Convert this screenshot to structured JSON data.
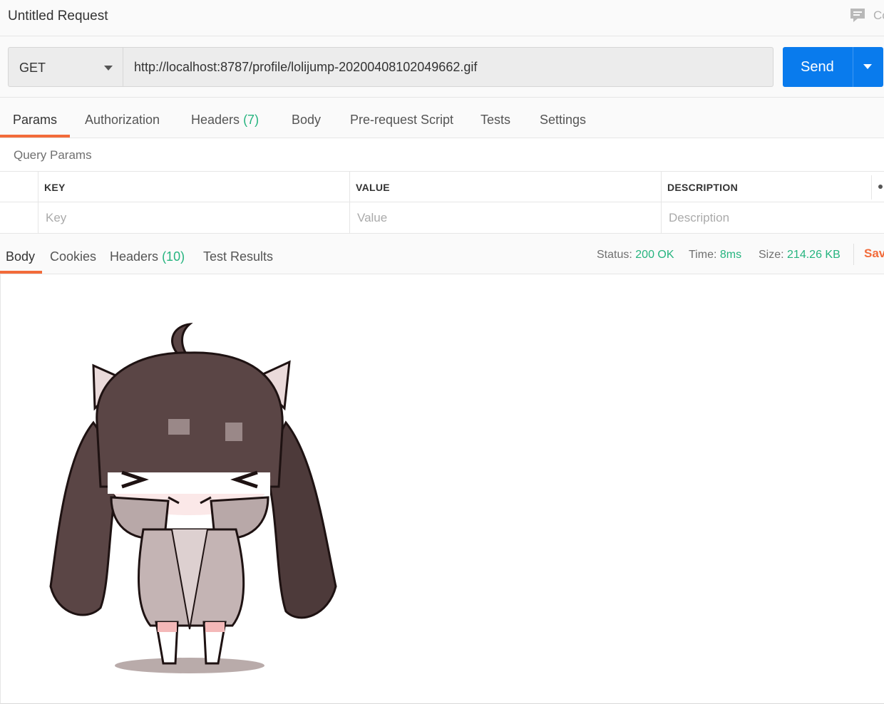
{
  "window": {
    "title": "Untitled Request",
    "comments_label": "Co"
  },
  "request": {
    "method": "GET",
    "url": "http://localhost:8787/profile/lolijump-20200408102049662.gif",
    "send_label": "Send"
  },
  "request_tabs": [
    {
      "label": "Params",
      "active": true
    },
    {
      "label": "Authorization"
    },
    {
      "label": "Headers",
      "count": "(7)"
    },
    {
      "label": "Body"
    },
    {
      "label": "Pre-request Script"
    },
    {
      "label": "Tests"
    },
    {
      "label": "Settings"
    }
  ],
  "query_params": {
    "title": "Query Params",
    "columns": [
      "KEY",
      "VALUE",
      "DESCRIPTION"
    ],
    "placeholders": [
      "Key",
      "Value",
      "Description"
    ]
  },
  "response_tabs": [
    {
      "label": "Body",
      "active": true
    },
    {
      "label": "Cookies"
    },
    {
      "label": "Headers",
      "count": "(10)"
    },
    {
      "label": "Test Results"
    }
  ],
  "response_meta": {
    "status_key": "Status:",
    "status_value": "200 OK",
    "time_key": "Time:",
    "time_value": "8ms",
    "size_key": "Size:",
    "size_value": "214.26 KB",
    "save_label": "Sav"
  },
  "icons": {
    "comments": "comment-icon",
    "method_caret": "chevron-down-icon",
    "send_caret": "chevron-down-icon",
    "more": "more-icon"
  },
  "colors": {
    "accent": "#f26b3a",
    "send": "#097bed",
    "success": "#26b47f"
  }
}
